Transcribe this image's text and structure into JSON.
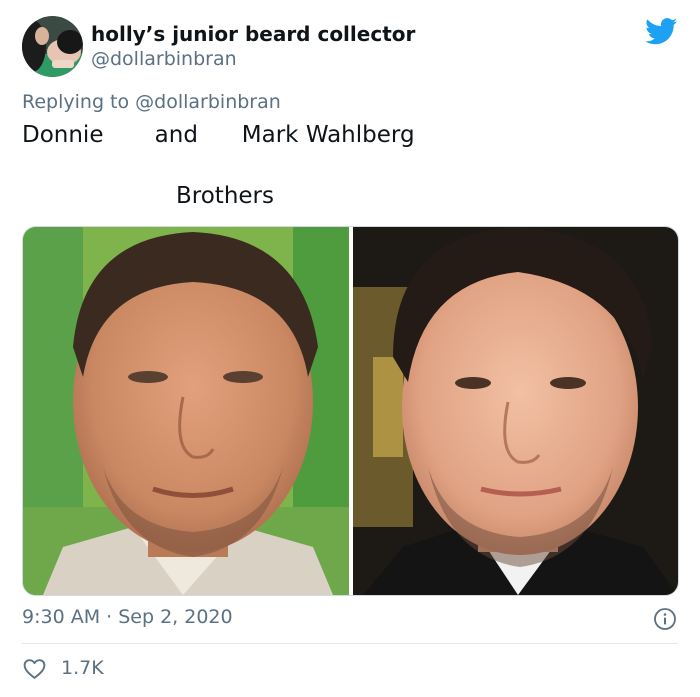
{
  "tweet": {
    "display_name": "holly’s junior beard collector",
    "handle": "@dollarbinbran",
    "replying_prefix": "Replying to ",
    "replying_handle": "@dollarbinbran",
    "text_line_1": "Donnie       and      Mark Wahlberg",
    "text_line_2": "Brothers",
    "timestamp": "9:30 AM · Sep 2, 2020",
    "like_count": "1.7K"
  },
  "icons": {
    "brand": "twitter-bird-icon",
    "info": "info-icon",
    "like": "heart-icon"
  },
  "colors": {
    "brand_blue": "#1da1f2",
    "text_primary": "#0f1419",
    "text_secondary": "#5b7083",
    "divider": "#e1e8ed"
  }
}
